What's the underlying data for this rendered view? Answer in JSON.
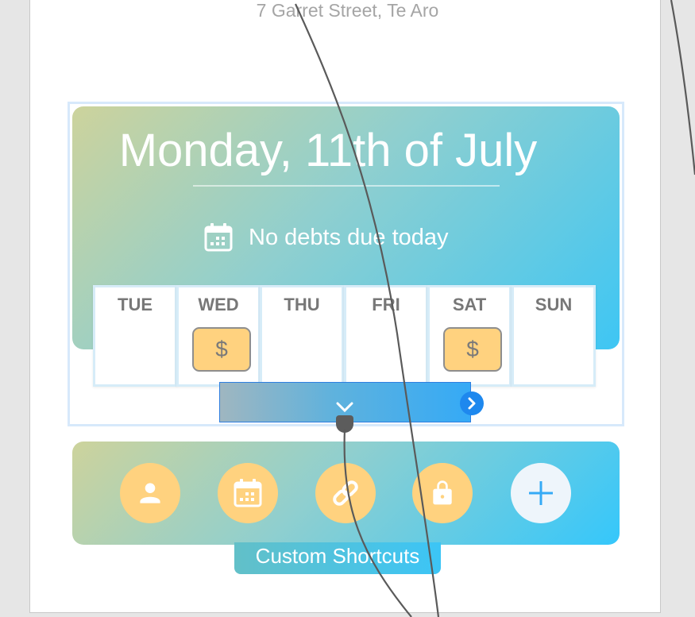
{
  "address": "7 Garret Street, Te Aro",
  "date_title": "Monday, 11th of July",
  "debt_status": "No debts due today",
  "week": [
    {
      "label": "TUE",
      "has_debt": false
    },
    {
      "label": "WED",
      "has_debt": true,
      "icon": "$"
    },
    {
      "label": "THU",
      "has_debt": false
    },
    {
      "label": "FRI",
      "has_debt": false
    },
    {
      "label": "SAT",
      "has_debt": true,
      "icon": "$"
    },
    {
      "label": "SUN",
      "has_debt": false
    }
  ],
  "shortcuts": {
    "label": "Custom Shortcuts",
    "items": [
      "person-icon",
      "calendar-icon",
      "link-icon",
      "bag-icon",
      "add-icon"
    ]
  },
  "colors": {
    "gradient_start": "#cdd39c",
    "gradient_end": "#35c7fb",
    "debt_badge": "#ffd27f",
    "accent_blue": "#1e88ee"
  }
}
